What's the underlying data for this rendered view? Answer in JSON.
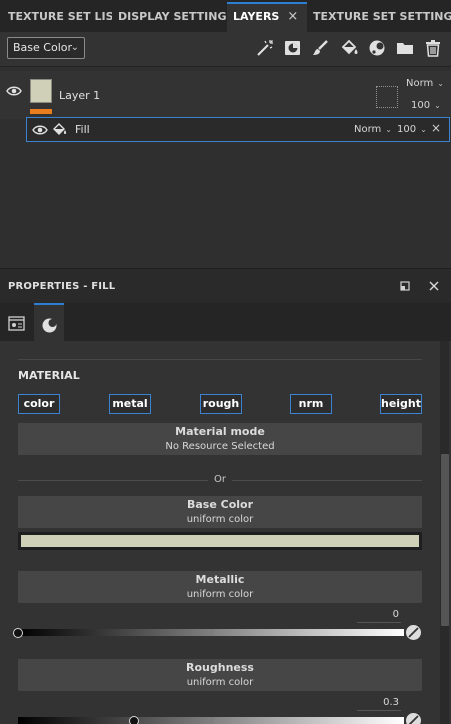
{
  "tabs": [
    {
      "label": "TEXTURE SET LIST",
      "active": false
    },
    {
      "label": "DISPLAY SETTINGS",
      "active": false
    },
    {
      "label": "LAYERS",
      "active": true
    },
    {
      "label": "TEXTURE SET SETTINGS",
      "active": false
    }
  ],
  "tab_close_glyph": "×",
  "toolbar": {
    "channel_select": "Base Color",
    "icons": [
      "magic-wand-icon",
      "smart-mask-icon",
      "paint-brush-icon",
      "fill-bucket-icon",
      "effects-icon",
      "folder-icon",
      "trash-icon"
    ]
  },
  "layers": {
    "layer1": {
      "name": "Layer 1",
      "blend_mode": "Norm",
      "opacity": "100",
      "thumbnail_color": "#d0d0b8",
      "material_indicator_color": "#e87e1e"
    },
    "fill": {
      "name": "Fill",
      "blend_mode": "Norm",
      "opacity": "100",
      "close_glyph": "×"
    }
  },
  "properties": {
    "title": "PROPERTIES - FILL",
    "material_section": "MATERIAL",
    "channels": [
      "color",
      "metal",
      "rough",
      "nrm",
      "height"
    ],
    "material_mode": {
      "title": "Material mode",
      "value": "No Resource Selected"
    },
    "or_label": "Or",
    "base_color": {
      "title": "Base Color",
      "mode": "uniform color",
      "color": "#d0d0b8"
    },
    "metallic": {
      "title": "Metallic",
      "mode": "uniform color",
      "value": "0",
      "fraction": 0.0
    },
    "roughness": {
      "title": "Roughness",
      "mode": "uniform color",
      "value": "0.3",
      "fraction": 0.3
    }
  },
  "colors": {
    "accent_blue": "#2d7fd3",
    "panel_bg": "#333333",
    "tab_bg": "#252525",
    "orange_indicator": "#e87e1e"
  }
}
